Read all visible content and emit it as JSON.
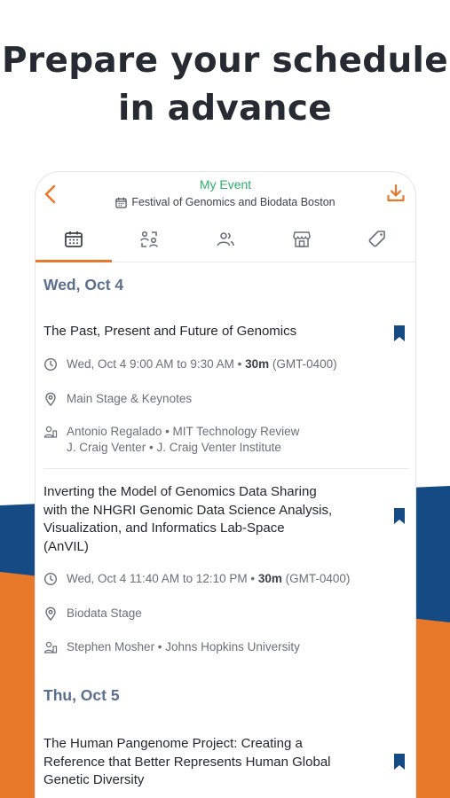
{
  "headline": {
    "line1": "Prepare your schedule",
    "line2": "in advance"
  },
  "colors": {
    "accent": "#e8782a",
    "green": "#2fae6b",
    "navy": "#154b84",
    "day_heading": "#5a6f8e"
  },
  "topbar": {
    "event_title": "My Event",
    "event_subtitle": "Festival of Genomics and Biodata Boston",
    "back_icon": "chevron-left-icon",
    "download_icon": "download-icon"
  },
  "tabs": [
    {
      "icon": "calendar-icon",
      "active": true
    },
    {
      "icon": "networking-icon",
      "active": false
    },
    {
      "icon": "people-icon",
      "active": false
    },
    {
      "icon": "exhibitor-booth-icon",
      "active": false
    },
    {
      "icon": "tag-icon",
      "active": false
    }
  ],
  "days": [
    {
      "label": "Wed, Oct 4",
      "sessions": [
        {
          "title_lines": [
            "The Past, Present and Future of Genomics"
          ],
          "time": "Wed, Oct 4 9:00 AM to 9:30 AM •",
          "duration": "30m",
          "tz": "(GMT-0400)",
          "location": "Main Stage & Keynotes",
          "speakers": [
            "Antonio Regalado • MIT Technology Review",
            "J. Craig Venter • J. Craig Venter Institute"
          ]
        },
        {
          "title_lines": [
            "Inverting the Model of Genomics Data Sharing",
            "with the NHGRI Genomic Data Science Analysis,",
            "Visualization, and Informatics Lab-Space",
            "(AnVIL)"
          ],
          "time": "Wed, Oct 4 11:40 AM to 12:10 PM •",
          "duration": "30m",
          "tz": "(GMT-0400)",
          "location": "Biodata Stage",
          "speakers": [
            "Stephen Mosher • Johns Hopkins University"
          ]
        }
      ]
    },
    {
      "label": "Thu, Oct 5",
      "sessions": [
        {
          "title_lines": [
            "The Human Pangenome Project: Creating a",
            "Reference that Better Represents Human Global",
            "Genetic Diversity"
          ]
        }
      ]
    }
  ]
}
